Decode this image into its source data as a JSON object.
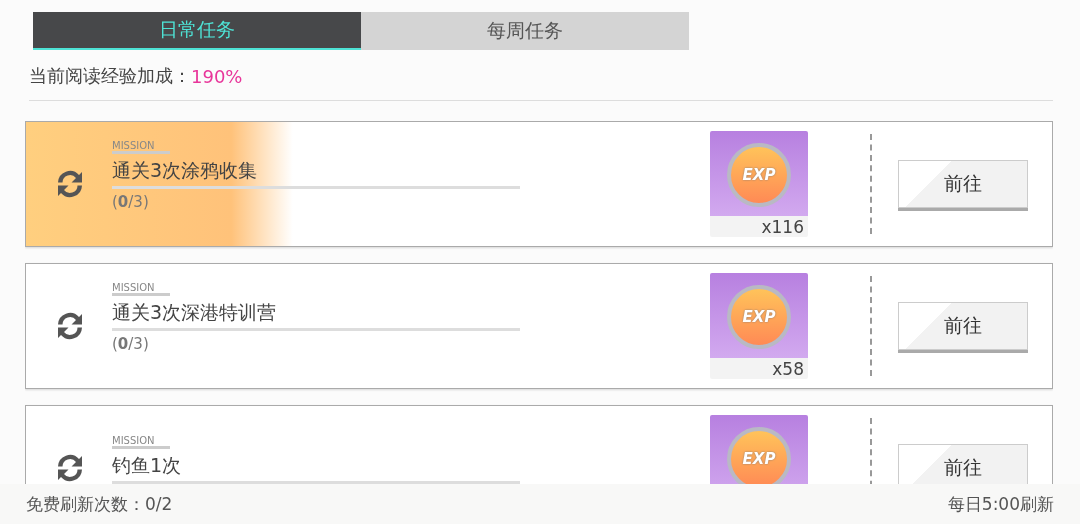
{
  "tabs": [
    {
      "label": "日常任务",
      "selected": true
    },
    {
      "label": "每周任务",
      "selected": false
    }
  ],
  "bonus": {
    "label": "当前阅读经验加成：",
    "value": "190%"
  },
  "missions": [
    {
      "tag": "MISSION",
      "title": "通关3次涂鸦收集",
      "progress": "(**0**/3)",
      "highlighted": true,
      "reward": {
        "coin_label": "EXP",
        "count": "x116"
      },
      "button": "前往"
    },
    {
      "tag": "MISSION",
      "title": "通关3次深港特训营",
      "progress": "(**0**/3)",
      "highlighted": false,
      "reward": {
        "coin_label": "EXP",
        "count": "x58"
      },
      "button": "前往"
    },
    {
      "tag": "MISSION",
      "title": "钓鱼1次",
      "highlighted": false,
      "reward": {
        "coin_label": "EXP"
      },
      "button": "前往"
    }
  ],
  "footer": {
    "refresh_count": "免费刷新次数：0/2",
    "reset_time": "每日5:00刷新"
  }
}
